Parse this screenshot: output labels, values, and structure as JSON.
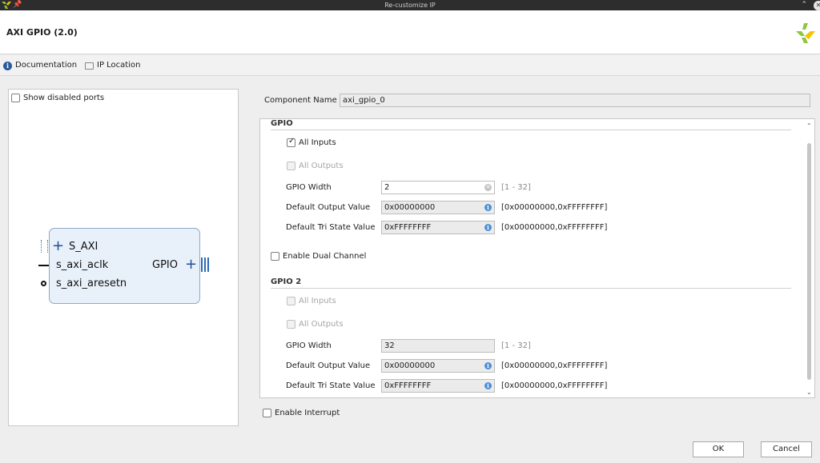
{
  "window": {
    "title": "Re-customize IP",
    "pin_glyph": "📌",
    "collapse_glyph": "⌃",
    "close_glyph": "✕"
  },
  "header": {
    "ip_title": "AXI GPIO (2.0)"
  },
  "toolbar": {
    "documentation_label": "Documentation",
    "ip_location_label": "IP Location"
  },
  "left_panel": {
    "show_disabled_ports_label": "Show disabled ports",
    "show_disabled_ports_checked": false,
    "block": {
      "ports_left": [
        "S_AXI",
        "s_axi_aclk",
        "s_axi_aresetn"
      ],
      "port_right": "GPIO",
      "plus_glyph": "+"
    }
  },
  "component": {
    "label": "Component Name",
    "value": "axi_gpio_0"
  },
  "gpio": {
    "title": "GPIO",
    "all_inputs_label": "All Inputs",
    "all_inputs_checked": true,
    "all_outputs_label": "All Outputs",
    "all_outputs_checked": false,
    "width_label": "GPIO Width",
    "width_value": "2",
    "width_range": "[1 - 32]",
    "default_output_label": "Default Output Value",
    "default_output_value": "0x00000000",
    "default_output_range": "[0x00000000,0xFFFFFFFF]",
    "default_tri_label": "Default Tri State Value",
    "default_tri_value": "0xFFFFFFFF",
    "default_tri_range": "[0x00000000,0xFFFFFFFF]"
  },
  "dual_channel": {
    "label": "Enable Dual Channel",
    "checked": false
  },
  "gpio2": {
    "title": "GPIO 2",
    "all_inputs_label": "All Inputs",
    "all_outputs_label": "All Outputs",
    "width_label": "GPIO Width",
    "width_value": "32",
    "width_range": "[1 - 32]",
    "default_output_label": "Default Output Value",
    "default_output_value": "0x00000000",
    "default_output_range": "[0x00000000,0xFFFFFFFF]",
    "default_tri_label": "Default Tri State Value",
    "default_tri_value": "0xFFFFFFFF",
    "default_tri_range": "[0x00000000,0xFFFFFFFF]"
  },
  "interrupt": {
    "label": "Enable Interrupt",
    "checked": false
  },
  "buttons": {
    "ok": "OK",
    "cancel": "Cancel"
  },
  "icons": {
    "info_glyph": "i",
    "clear_glyph": "✕",
    "scroll_up_glyph": "⌃",
    "scroll_down_glyph": "⌄"
  },
  "colors": {
    "brand_green": "#8dc63f",
    "brand_yellow": "#f2c500",
    "block_fill": "#e8f0fa",
    "accent_blue": "#2a5a9a"
  }
}
